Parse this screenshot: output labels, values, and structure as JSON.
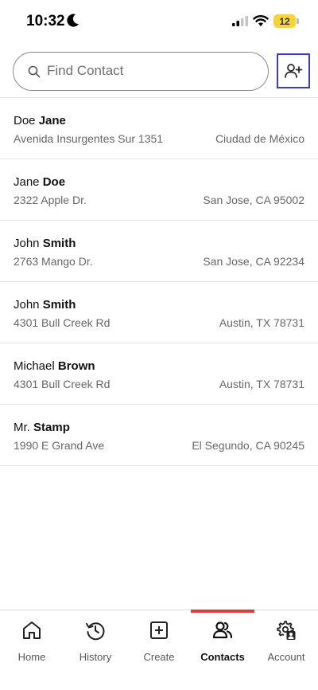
{
  "status_bar": {
    "time": "10:32",
    "battery_level": "12",
    "icons": [
      "moon-icon",
      "signal-icon",
      "wifi-icon",
      "battery-icon"
    ]
  },
  "search": {
    "placeholder": "Find Contact",
    "value": ""
  },
  "toolbar": {
    "add_contact_icon": "person-add-icon"
  },
  "contacts": [
    {
      "first": "Doe",
      "last": "Jane",
      "street": "Avenida Insurgentes Sur 1351",
      "city": "Ciudad de México"
    },
    {
      "first": "Jane",
      "last": "Doe",
      "street": "2322 Apple Dr.",
      "city": "San Jose, CA 95002"
    },
    {
      "first": "John",
      "last": "Smith",
      "street": "2763 Mango Dr.",
      "city": "San Jose, CA 92234"
    },
    {
      "first": "John",
      "last": "Smith",
      "street": "4301 Bull Creek Rd",
      "city": "Austin, TX 78731"
    },
    {
      "first": "Michael",
      "last": "Brown",
      "street": "4301 Bull Creek Rd",
      "city": "Austin, TX 78731"
    },
    {
      "first": "Mr.",
      "last": "Stamp",
      "street": "1990 E Grand Ave",
      "city": "El Segundo, CA 90245"
    }
  ],
  "bottom_nav": {
    "active_tab": "Contacts",
    "active_color": "#e53935",
    "items": [
      {
        "label": "Home",
        "icon": "home-icon"
      },
      {
        "label": "History",
        "icon": "history-icon"
      },
      {
        "label": "Create",
        "icon": "create-icon"
      },
      {
        "label": "Contacts",
        "icon": "contacts-icon"
      },
      {
        "label": "Account",
        "icon": "account-settings-icon"
      }
    ]
  }
}
